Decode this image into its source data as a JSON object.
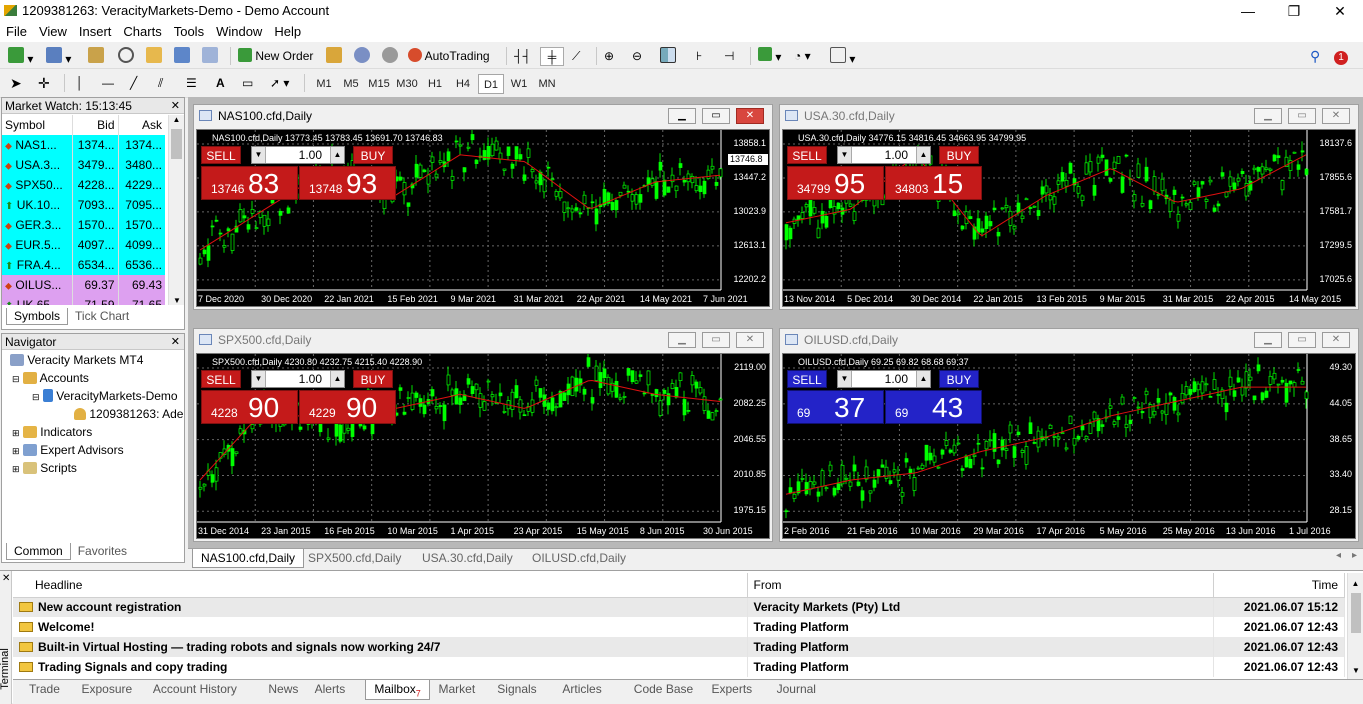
{
  "window": {
    "title": "1209381263: VeracityMarkets-Demo - Demo Account",
    "minimize": "—",
    "restore": "❐",
    "close": "✕"
  },
  "menu": [
    "File",
    "View",
    "Insert",
    "Charts",
    "Tools",
    "Window",
    "Help"
  ],
  "toolbar": {
    "new_order": "New Order",
    "autotrading": "AutoTrading",
    "notifications": "1"
  },
  "timeframes": [
    "M1",
    "M5",
    "M15",
    "M30",
    "H1",
    "H4",
    "D1",
    "W1",
    "MN"
  ],
  "timeframe_active": "D1",
  "market_watch": {
    "title": "Market Watch: 15:13:45",
    "headers": {
      "symbol": "Symbol",
      "bid": "Bid",
      "ask": "Ask"
    },
    "rows": [
      {
        "symbol": "NAS1...",
        "bid": "1374...",
        "ask": "1374...",
        "color": "#00ffff"
      },
      {
        "symbol": "USA.3...",
        "bid": "3479...",
        "ask": "3480...",
        "color": "#00ffff"
      },
      {
        "symbol": "SPX50...",
        "bid": "4228...",
        "ask": "4229...",
        "color": "#00ffff"
      },
      {
        "symbol": "UK.10...",
        "bid": "7093...",
        "ask": "7095...",
        "color": "#00ffff"
      },
      {
        "symbol": "GER.3...",
        "bid": "1570...",
        "ask": "1570...",
        "color": "#00ffff"
      },
      {
        "symbol": "EUR.5...",
        "bid": "4097...",
        "ask": "4099...",
        "color": "#00ffff"
      },
      {
        "symbol": "FRA.4...",
        "bid": "6534...",
        "ask": "6536...",
        "color": "#00ffff"
      },
      {
        "symbol": "OILUS...",
        "bid": "69.37",
        "ask": "69.43",
        "color": "#dda0f0"
      },
      {
        "symbol": "UK.65...",
        "bid": "71.59",
        "ask": "71.65",
        "color": "#dda0f0"
      }
    ],
    "tabs": [
      "Symbols",
      "Tick Chart"
    ]
  },
  "navigator": {
    "title": "Navigator",
    "root": "Veracity Markets MT4",
    "accounts": "Accounts",
    "server": "VeracityMarkets-Demo",
    "account": "1209381263: Ade",
    "indicators": "Indicators",
    "experts": "Expert Advisors",
    "scripts": "Scripts",
    "tabs": [
      "Common",
      "Favorites"
    ]
  },
  "charts": [
    {
      "title": "NAS100.cfd,Daily",
      "info": "NAS100.cfd,Daily  13773.45 13783.45 13691.70 13746.83",
      "lot": "1.00",
      "sell_small": "13746",
      "sell_big": "83",
      "buy_small": "13748",
      "buy_big": "93",
      "y": [
        "13858.1",
        "13447.2",
        "13023.9",
        "12613.1",
        "12202.2"
      ],
      "last": "13746.8",
      "x": [
        "7 Dec 2020",
        "30 Dec 2020",
        "22 Jan 2021",
        "15 Feb 2021",
        "9 Mar 2021",
        "31 Mar 2021",
        "22 Apr 2021",
        "14 May 2021",
        "7 Jun 2021"
      ],
      "blue": false,
      "active": true
    },
    {
      "title": "USA.30.cfd,Daily",
      "info": "USA.30.cfd,Daily  34776.15 34816.45 34663.95 34799.95",
      "lot": "1.00",
      "sell_small": "34799",
      "sell_big": "95",
      "buy_small": "34803",
      "buy_big": "15",
      "y": [
        "18137.6",
        "17855.6",
        "17581.7",
        "17299.5",
        "17025.6"
      ],
      "last": "",
      "x": [
        "13 Nov 2014",
        "5 Dec 2014",
        "30 Dec 2014",
        "22 Jan 2015",
        "13 Feb 2015",
        "9 Mar 2015",
        "31 Mar 2015",
        "22 Apr 2015",
        "14 May 2015"
      ],
      "blue": false,
      "active": false
    },
    {
      "title": "SPX500.cfd,Daily",
      "info": "SPX500.cfd,Daily  4230.80 4232.75 4215.40 4228.90",
      "lot": "1.00",
      "sell_small": "4228",
      "sell_big": "90",
      "buy_small": "4229",
      "buy_big": "90",
      "y": [
        "2119.00",
        "2082.25",
        "2046.55",
        "2010.85",
        "1975.15"
      ],
      "last": "",
      "x": [
        "31 Dec 2014",
        "23 Jan 2015",
        "16 Feb 2015",
        "10 Mar 2015",
        "1 Apr 2015",
        "23 Apr 2015",
        "15 May 2015",
        "8 Jun 2015",
        "30 Jun 2015"
      ],
      "blue": false,
      "active": false
    },
    {
      "title": "OILUSD.cfd,Daily",
      "info": "OILUSD.cfd,Daily  69.25 69.82 68.68 69.37",
      "lot": "1.00",
      "sell_small": "69",
      "sell_big": "37",
      "buy_small": "69",
      "buy_big": "43",
      "y": [
        "49.30",
        "44.05",
        "38.65",
        "33.40",
        "28.15"
      ],
      "last": "",
      "x": [
        "2 Feb 2016",
        "21 Feb 2016",
        "10 Mar 2016",
        "29 Mar 2016",
        "17 Apr 2016",
        "5 May 2016",
        "25 May 2016",
        "13 Jun 2016",
        "1 Jul 2016"
      ],
      "blue": true,
      "active": false
    }
  ],
  "chart_tabs": [
    "NAS100.cfd,Daily",
    "SPX500.cfd,Daily",
    "USA.30.cfd,Daily",
    "OILUSD.cfd,Daily"
  ],
  "sell_label": "SELL",
  "buy_label": "BUY",
  "terminal": {
    "side_label": "Terminal",
    "headers": {
      "headline": "Headline",
      "from": "From",
      "time": "Time"
    },
    "rows": [
      {
        "headline": "New account registration",
        "from": "Veracity Markets (Pty) Ltd",
        "time": "2021.06.07 15:12"
      },
      {
        "headline": "Welcome!",
        "from": "Trading Platform",
        "time": "2021.06.07 12:43"
      },
      {
        "headline": "Built-in Virtual Hosting — trading robots and signals now working 24/7",
        "from": "Trading Platform",
        "time": "2021.06.07 12:43"
      },
      {
        "headline": "Trading Signals and copy trading",
        "from": "Trading Platform",
        "time": "2021.06.07 12:43"
      }
    ],
    "tabs": [
      "Trade",
      "Exposure",
      "Account History",
      "News",
      "Alerts",
      "Mailbox",
      "Market",
      "Signals",
      "Articles",
      "Code Base",
      "Experts",
      "Journal"
    ],
    "mailbox_count": "7"
  }
}
